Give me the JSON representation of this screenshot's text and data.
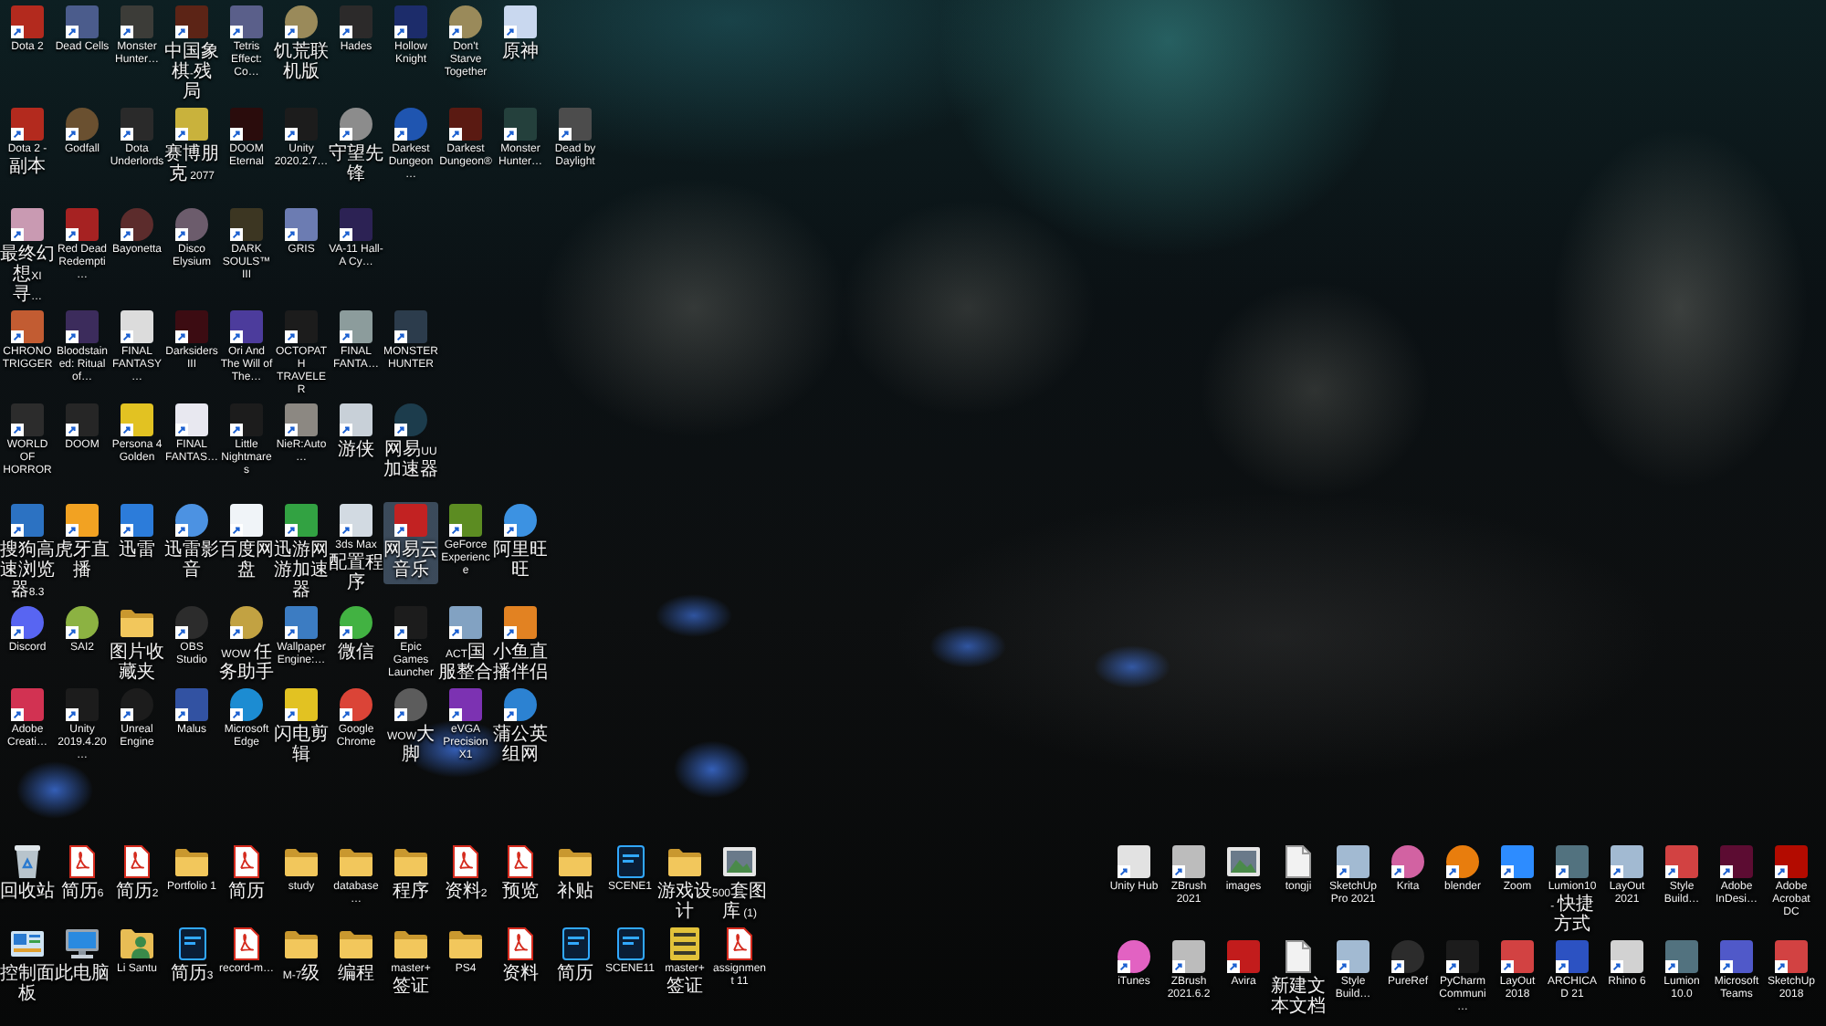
{
  "desktop": {
    "icon_groups": [
      {
        "rows": [
          [
            {
              "label": "Dota 2",
              "kind": "app",
              "color": "#b32a1e",
              "shortcut": true,
              "selected": false
            },
            {
              "label": "Dead Cells",
              "kind": "app",
              "color": "#4b5c8c",
              "shortcut": true,
              "selected": false
            },
            {
              "label": "Monster Hunter…",
              "kind": "app",
              "color": "#3c3c38",
              "shortcut": true,
              "selected": false
            },
            {
              "label": "中国象棋-残局",
              "kind": "app",
              "color": "#5c2416",
              "shortcut": true,
              "selected": false
            },
            {
              "label": "Tetris Effect: Co…",
              "kind": "app",
              "color": "#5a5f8a",
              "shortcut": true,
              "selected": false
            },
            {
              "label": "饥荒联机版",
              "kind": "round-app",
              "color": "#9a8a5a",
              "shortcut": true,
              "selected": false
            },
            {
              "label": "Hades",
              "kind": "app",
              "color": "#2c2a2a",
              "shortcut": true,
              "selected": false
            },
            {
              "label": "Hollow Knight",
              "kind": "app",
              "color": "#1c2c6a",
              "shortcut": true,
              "selected": false
            },
            {
              "label": "Don't Starve Together",
              "kind": "round-app",
              "color": "#9a8a5a",
              "shortcut": true,
              "selected": false
            },
            {
              "label": "原神",
              "kind": "app",
              "color": "#c9d8ef",
              "shortcut": true,
              "selected": false
            }
          ],
          [
            {
              "label": "Dota 2 - 副本",
              "kind": "app",
              "color": "#b32a1e",
              "shortcut": true,
              "selected": false
            },
            {
              "label": "Godfall",
              "kind": "round-app",
              "color": "#6a5030",
              "shortcut": true,
              "selected": false
            },
            {
              "label": "Dota Underlords",
              "kind": "app",
              "color": "#2a2a2a",
              "shortcut": true,
              "selected": false
            },
            {
              "label": "赛博朋克 2077",
              "kind": "app",
              "color": "#c9b23c",
              "shortcut": true,
              "selected": false
            },
            {
              "label": "DOOM Eternal",
              "kind": "app",
              "color": "#2a0c0c",
              "shortcut": true,
              "selected": false
            },
            {
              "label": "Unity 2020.2.7…",
              "kind": "app",
              "color": "#1c1c1c",
              "shortcut": true,
              "selected": false
            },
            {
              "label": "守望先锋",
              "kind": "round-app",
              "color": "#8c8c8c",
              "shortcut": true,
              "selected": false
            },
            {
              "label": "Darkest Dungeon…",
              "kind": "round-app",
              "color": "#1f55b0",
              "shortcut": true,
              "selected": false
            },
            {
              "label": "Darkest Dungeon®",
              "kind": "app",
              "color": "#5a1a12",
              "shortcut": true,
              "selected": false
            },
            {
              "label": "Monster Hunter…",
              "kind": "app",
              "color": "#24403c",
              "shortcut": true,
              "selected": false
            },
            {
              "label": "Dead by Daylight",
              "kind": "app",
              "color": "#4c4c4c",
              "shortcut": true,
              "selected": false
            }
          ]
        ]
      },
      {
        "rows": [
          [
            {
              "label": "最终幻想XI 寻…",
              "kind": "app",
              "color": "#c99ab2",
              "shortcut": true,
              "selected": false
            },
            {
              "label": "Red Dead Redempti…",
              "kind": "app",
              "color": "#a62222",
              "shortcut": true,
              "selected": false
            },
            {
              "label": "Bayonetta",
              "kind": "round-app",
              "color": "#5c2c2c",
              "shortcut": true,
              "selected": false
            },
            {
              "label": "Disco Elysium",
              "kind": "round-app",
              "color": "#6c5c6c",
              "shortcut": true,
              "selected": false
            },
            {
              "label": "DARK SOULS™ III",
              "kind": "app",
              "color": "#3c3622",
              "shortcut": true,
              "selected": false
            },
            {
              "label": "GRIS",
              "kind": "app",
              "color": "#6c7cb2",
              "shortcut": true,
              "selected": false
            },
            {
              "label": "VA-11 Hall-A Cy…",
              "kind": "app",
              "color": "#2c2254",
              "shortcut": true,
              "selected": false
            }
          ],
          [
            {
              "label": "CHRONO TRIGGER",
              "kind": "app",
              "color": "#c25c32",
              "shortcut": true,
              "selected": false
            },
            {
              "label": "Bloodstained: Ritual of…",
              "kind": "app",
              "color": "#3c2c5c",
              "shortcut": true,
              "selected": false
            },
            {
              "label": "FINAL FANTASY…",
              "kind": "app",
              "color": "#dcdcdc",
              "shortcut": true,
              "selected": false
            },
            {
              "label": "Darksiders III",
              "kind": "app",
              "color": "#3c0c12",
              "shortcut": true,
              "selected": false
            },
            {
              "label": "Ori And The Will of The…",
              "kind": "app",
              "color": "#4c3c9c",
              "shortcut": true,
              "selected": false
            },
            {
              "label": "OCTOPATH TRAVELER",
              "kind": "app",
              "color": "#1c1c1c",
              "shortcut": true,
              "selected": false
            },
            {
              "label": "FINAL FANTA…",
              "kind": "app",
              "color": "#8c9c9c",
              "shortcut": true,
              "selected": false
            },
            {
              "label": "MONSTER HUNTER",
              "kind": "app",
              "color": "#2c3c4c",
              "shortcut": true,
              "selected": false
            }
          ],
          [
            {
              "label": "WORLD OF HORROR",
              "kind": "app",
              "color": "#2c2c2c",
              "shortcut": true,
              "selected": false
            },
            {
              "label": "DOOM",
              "kind": "app",
              "color": "#262626",
              "shortcut": true,
              "selected": false
            },
            {
              "label": "Persona 4 Golden",
              "kind": "app",
              "color": "#e2c222",
              "shortcut": true,
              "selected": false
            },
            {
              "label": "FINAL FANTAS…",
              "kind": "app",
              "color": "#e8e8f0",
              "shortcut": true,
              "selected": false
            },
            {
              "label": "Little Nightmares",
              "kind": "app",
              "color": "#1c1c1c",
              "shortcut": true,
              "selected": false
            },
            {
              "label": "NieR:Auto…",
              "kind": "app",
              "color": "#8c8882",
              "shortcut": true,
              "selected": false
            },
            {
              "label": "游侠",
              "kind": "app",
              "color": "#c8d0d8",
              "shortcut": true,
              "selected": false
            },
            {
              "label": "网易UU加速器",
              "kind": "round-app",
              "color": "#1c3c4c",
              "shortcut": true,
              "selected": false
            }
          ]
        ]
      },
      {
        "rows": [
          [
            {
              "label": "搜狗高速浏览器8.3",
              "kind": "app",
              "color": "#2c72c2",
              "shortcut": true,
              "selected": false
            },
            {
              "label": "虎牙直播",
              "kind": "app",
              "color": "#f2a222",
              "shortcut": true,
              "selected": false
            },
            {
              "label": "迅雷",
              "kind": "app",
              "color": "#2c7cda",
              "shortcut": true,
              "selected": false
            },
            {
              "label": "迅雷影音",
              "kind": "round-app",
              "color": "#4c92e2",
              "shortcut": true,
              "selected": false
            },
            {
              "label": "百度网盘",
              "kind": "app",
              "color": "#f0f4f8",
              "shortcut": true,
              "selected": false
            },
            {
              "label": "迅游网游加速器",
              "kind": "app",
              "color": "#32a242",
              "shortcut": true,
              "selected": false
            },
            {
              "label": "3ds Max 配置程序",
              "kind": "app",
              "color": "#d2dae2",
              "shortcut": true,
              "selected": false
            },
            {
              "label": "网易云音乐",
              "kind": "app",
              "color": "#c22222",
              "shortcut": true,
              "selected": true
            },
            {
              "label": "GeForce Experience",
              "kind": "app",
              "color": "#5c8c22",
              "shortcut": true,
              "selected": false
            },
            {
              "label": "阿里旺旺",
              "kind": "round-app",
              "color": "#3c92e2",
              "shortcut": true,
              "selected": false
            }
          ],
          [
            {
              "label": "Discord",
              "kind": "round-app",
              "color": "#5865f2",
              "shortcut": true,
              "selected": false
            },
            {
              "label": "SAI2",
              "kind": "round-app",
              "color": "#8cb242",
              "shortcut": true,
              "selected": false
            },
            {
              "label": "图片收藏夹",
              "kind": "folder",
              "shortcut": false,
              "selected": false
            },
            {
              "label": "OBS Studio",
              "kind": "round-app",
              "color": "#2c2c2c",
              "shortcut": true,
              "selected": false
            },
            {
              "label": "WOW 任务助手",
              "kind": "round-app",
              "color": "#c2a242",
              "shortcut": true,
              "selected": false
            },
            {
              "label": "Wallpaper Engine:…",
              "kind": "app",
              "color": "#3c7cc2",
              "shortcut": true,
              "selected": false
            },
            {
              "label": "微信",
              "kind": "round-app",
              "color": "#42b242",
              "shortcut": true,
              "selected": false
            },
            {
              "label": "Epic Games Launcher",
              "kind": "app",
              "color": "#1c1c1c",
              "shortcut": true,
              "selected": false
            },
            {
              "label": "ACT国服整合",
              "kind": "app",
              "color": "#82a2c2",
              "shortcut": true,
              "selected": false
            },
            {
              "label": "小鱼直播伴侣",
              "kind": "app",
              "color": "#e28222",
              "shortcut": true,
              "selected": false
            }
          ],
          [
            {
              "label": "Adobe Creati…",
              "kind": "app",
              "color": "#d23252",
              "shortcut": true,
              "selected": false
            },
            {
              "label": "Unity 2019.4.20…",
              "kind": "app",
              "color": "#1c1c1c",
              "shortcut": true,
              "selected": false
            },
            {
              "label": "Unreal Engine",
              "kind": "round-app",
              "color": "#1c1c1c",
              "shortcut": true,
              "selected": false
            },
            {
              "label": "Malus",
              "kind": "app",
              "color": "#3252a2",
              "shortcut": true,
              "selected": false
            },
            {
              "label": "Microsoft Edge",
              "kind": "round-app",
              "color": "#1c8cd2",
              "shortcut": true,
              "selected": false
            },
            {
              "label": "闪电剪辑",
              "kind": "app",
              "color": "#e2c222",
              "shortcut": true,
              "selected": false
            },
            {
              "label": "Google Chrome",
              "kind": "round-app",
              "color": "#db4437",
              "shortcut": true,
              "selected": false
            },
            {
              "label": "WOW大脚",
              "kind": "round-app",
              "color": "#5c5c5c",
              "shortcut": true,
              "selected": false
            },
            {
              "label": "eVGA Precision X1",
              "kind": "app",
              "color": "#7c32b2",
              "shortcut": true,
              "selected": false
            },
            {
              "label": "蒲公英组网",
              "kind": "round-app",
              "color": "#2c82d2",
              "shortcut": true,
              "selected": false
            }
          ]
        ]
      },
      {
        "rows": [
          [
            {
              "label": "回收站",
              "kind": "recycle-bin",
              "shortcut": false,
              "selected": false
            },
            {
              "label": "简历6",
              "kind": "pdf",
              "shortcut": false,
              "selected": false
            },
            {
              "label": "简历2",
              "kind": "pdf",
              "shortcut": false,
              "selected": false
            },
            {
              "label": "Portfolio 1",
              "kind": "folder",
              "shortcut": false,
              "selected": false
            },
            {
              "label": "简历",
              "kind": "pdf",
              "shortcut": false,
              "selected": false
            },
            {
              "label": "study",
              "kind": "folder",
              "shortcut": false,
              "selected": false
            },
            {
              "label": "database…",
              "kind": "folder",
              "shortcut": false,
              "selected": false
            },
            {
              "label": "程序",
              "kind": "folder",
              "shortcut": false,
              "selected": false
            },
            {
              "label": "资料2",
              "kind": "pdf",
              "shortcut": false,
              "selected": false
            },
            {
              "label": "预览",
              "kind": "pdf",
              "shortcut": false,
              "selected": false
            },
            {
              "label": "补贴",
              "kind": "folder",
              "shortcut": false,
              "selected": false
            },
            {
              "label": "SCENE1",
              "kind": "psd",
              "shortcut": false,
              "selected": false
            },
            {
              "label": "游戏设计",
              "kind": "folder",
              "shortcut": false,
              "selected": false
            },
            {
              "label": "500套图库 (1)",
              "kind": "image",
              "shortcut": false,
              "selected": false
            }
          ],
          [
            {
              "label": "控制面板",
              "kind": "control-panel",
              "shortcut": false,
              "selected": false
            },
            {
              "label": "此电脑",
              "kind": "computer",
              "shortcut": false,
              "selected": false
            },
            {
              "label": "Li Santu",
              "kind": "user-folder",
              "shortcut": false,
              "selected": false
            },
            {
              "label": "简历3",
              "kind": "psd",
              "shortcut": false,
              "selected": false
            },
            {
              "label": "record-m…",
              "kind": "pdf",
              "shortcut": false,
              "selected": false
            },
            {
              "label": "M-7级",
              "kind": "folder",
              "shortcut": false,
              "selected": false
            },
            {
              "label": "编程",
              "kind": "folder",
              "shortcut": false,
              "selected": false
            },
            {
              "label": "master+签证",
              "kind": "folder",
              "shortcut": false,
              "selected": false
            },
            {
              "label": "PS4",
              "kind": "folder",
              "shortcut": false,
              "selected": false
            },
            {
              "label": "资料",
              "kind": "pdf",
              "shortcut": false,
              "selected": false
            },
            {
              "label": "简历",
              "kind": "psd",
              "shortcut": false,
              "selected": false
            },
            {
              "label": "SCENE11",
              "kind": "psd",
              "shortcut": false,
              "selected": false
            },
            {
              "label": "master+签证",
              "kind": "archive",
              "shortcut": false,
              "selected": false
            },
            {
              "label": "assignment 11",
              "kind": "pdf",
              "shortcut": false,
              "selected": false
            }
          ]
        ]
      },
      {
        "rows": [
          [
            {
              "label": "Unity Hub",
              "kind": "app",
              "color": "#e2e2e2",
              "shortcut": true,
              "selected": false
            },
            {
              "label": "ZBrush 2021",
              "kind": "app",
              "color": "#bcbcbc",
              "shortcut": true,
              "selected": false
            },
            {
              "label": "images",
              "kind": "image",
              "shortcut": false,
              "selected": false
            },
            {
              "label": "tongji",
              "kind": "document",
              "shortcut": false,
              "selected": false
            },
            {
              "label": "SketchUp Pro 2021",
              "kind": "app",
              "color": "#a2bad2",
              "shortcut": true,
              "selected": false
            },
            {
              "label": "Krita",
              "kind": "round-app",
              "color": "#d262a2",
              "shortcut": true,
              "selected": false
            },
            {
              "label": "blender",
              "kind": "round-app",
              "color": "#e87d0d",
              "shortcut": true,
              "selected": false
            },
            {
              "label": "Zoom",
              "kind": "app",
              "color": "#2d8cff",
              "shortcut": true,
              "selected": false
            },
            {
              "label": "Lumion10 - 快捷方式",
              "kind": "app",
              "color": "#52727f",
              "shortcut": true,
              "selected": false
            },
            {
              "label": "LayOut 2021",
              "kind": "app",
              "color": "#a2bad2",
              "shortcut": true,
              "selected": false
            },
            {
              "label": "Style Build…",
              "kind": "app",
              "color": "#d24242",
              "shortcut": true,
              "selected": false
            },
            {
              "label": "Adobe InDesi…",
              "kind": "app",
              "color": "#5c0c32",
              "shortcut": true,
              "selected": false
            },
            {
              "label": "Adobe Acrobat DC",
              "kind": "app",
              "color": "#b30b00",
              "shortcut": true,
              "selected": false
            }
          ],
          [
            {
              "label": "iTunes",
              "kind": "round-app",
              "color": "#e262c2",
              "shortcut": true,
              "selected": false
            },
            {
              "label": "ZBrush 2021.6.2",
              "kind": "app",
              "color": "#bcbcbc",
              "shortcut": true,
              "selected": false
            },
            {
              "label": "Avira",
              "kind": "app",
              "color": "#c21c1c",
              "shortcut": true,
              "selected": false
            },
            {
              "label": "新建文本文档",
              "kind": "document",
              "shortcut": false,
              "selected": false
            },
            {
              "label": "Style Build…",
              "kind": "app",
              "color": "#a2bad2",
              "shortcut": true,
              "selected": false
            },
            {
              "label": "PureRef",
              "kind": "round-app",
              "color": "#2c2c2c",
              "shortcut": true,
              "selected": false
            },
            {
              "label": "PyCharm Communi…",
              "kind": "app",
              "color": "#1c1c1c",
              "shortcut": true,
              "selected": false
            },
            {
              "label": "LayOut 2018",
              "kind": "app",
              "color": "#d24242",
              "shortcut": true,
              "selected": false
            },
            {
              "label": "ARCHICAD 21",
              "kind": "app",
              "color": "#2c52c2",
              "shortcut": true,
              "selected": false
            },
            {
              "label": "Rhino 6",
              "kind": "app",
              "color": "#d2d2d2",
              "shortcut": true,
              "selected": false
            },
            {
              "label": "Lumion 10.0",
              "kind": "app",
              "color": "#52727f",
              "shortcut": true,
              "selected": false
            },
            {
              "label": "Microsoft Teams",
              "kind": "app",
              "color": "#5059c9",
              "shortcut": true,
              "selected": false
            },
            {
              "label": "SketchUp 2018",
              "kind": "app",
              "color": "#d24242",
              "shortcut": true,
              "selected": false
            }
          ]
        ]
      }
    ]
  }
}
